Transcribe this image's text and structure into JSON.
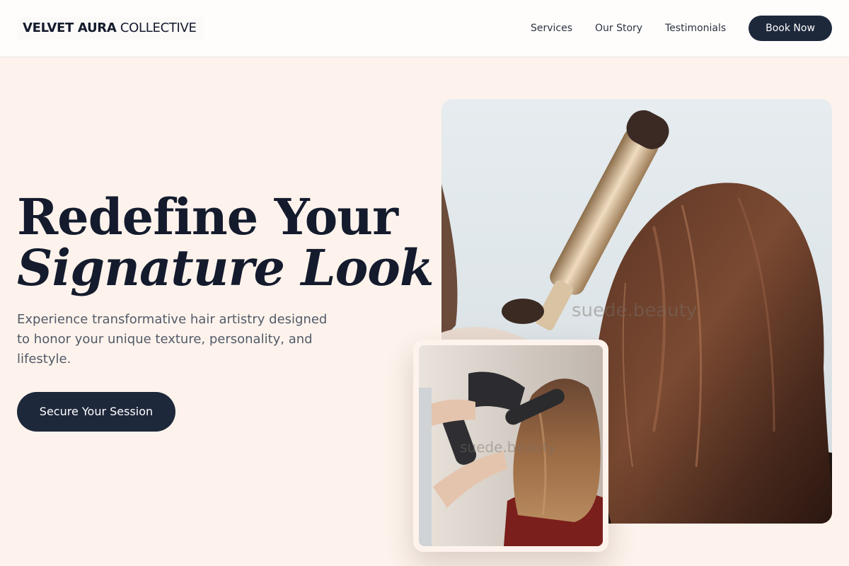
{
  "header": {
    "logo_strong": "VELVET AURA",
    "logo_light": "COLLECTIVE",
    "nav": [
      "Services",
      "Our Story",
      "Testimonials"
    ],
    "book_label": "Book Now"
  },
  "hero": {
    "headline_line1": "Redefine Your",
    "headline_line2": "Signature Look",
    "subtitle": "Experience transformative hair artistry designed to honor your unique texture, personality, and lifestyle.",
    "cta_label": "Secure Your Session"
  },
  "images": {
    "main_alt": "Stylist curling long brown hair with a curling iron",
    "main_watermark": "suede.beauty",
    "small_alt": "Stylist blow-drying hair with a round brush",
    "small_watermark": "suede.beauty"
  },
  "colors": {
    "background": "#fdf3ec",
    "accent_dark": "#1e283b",
    "text_dark": "#141b2d",
    "text_muted": "#525a69"
  }
}
